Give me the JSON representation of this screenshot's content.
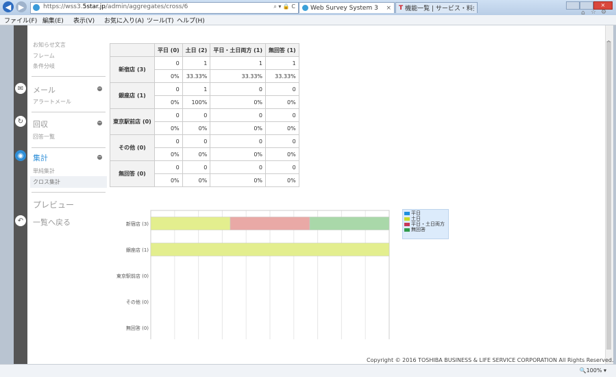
{
  "browser": {
    "url_prefix": "https://wss3.",
    "url_domain": "5star.jp",
    "url_path": "/admin/aggregates/cross/6",
    "addr_icons": "⌕ ▾ 🔒 C",
    "tab_active": "Web Survey System 3",
    "tab_other": "機能一覧 | サービス・料金 - ...",
    "menu": [
      "ファイル(F)",
      "編集(E)",
      "表示(V)",
      "お気に入り(A)",
      "ツール(T)",
      "ヘルプ(H)"
    ],
    "zoom": "100%"
  },
  "sidebar": {
    "top_items": [
      "お知らせ文言",
      "フレーム",
      "条件分岐"
    ],
    "mail": {
      "label": "メール",
      "sub": [
        "アラートメール"
      ]
    },
    "collect": {
      "label": "回収",
      "sub": [
        "回答一覧"
      ]
    },
    "aggregate": {
      "label": "集計",
      "sub": [
        "単純集計",
        "クロス集計"
      ]
    },
    "preview": "プレビュー",
    "back": "一覧へ戻る"
  },
  "table": {
    "columns": [
      "平日 (0)",
      "土日 (2)",
      "平日・土日両方 (1)",
      "無回答 (1)"
    ],
    "rows": [
      {
        "label": "新宿店 (3)",
        "counts": [
          "0",
          "1",
          "1",
          "1"
        ],
        "pcts": [
          "0%",
          "33.33%",
          "33.33%",
          "33.33%"
        ]
      },
      {
        "label": "銀座店 (1)",
        "counts": [
          "0",
          "1",
          "0",
          "0"
        ],
        "pcts": [
          "0%",
          "100%",
          "0%",
          "0%"
        ]
      },
      {
        "label": "東京駅前店 (0)",
        "counts": [
          "0",
          "0",
          "0",
          "0"
        ],
        "pcts": [
          "0%",
          "0%",
          "0%",
          "0%"
        ]
      },
      {
        "label": "その他 (0)",
        "counts": [
          "0",
          "0",
          "0",
          "0"
        ],
        "pcts": [
          "0%",
          "0%",
          "0%",
          "0%"
        ]
      },
      {
        "label": "無回答 (0)",
        "counts": [
          "0",
          "0",
          "0",
          "0"
        ],
        "pcts": [
          "0%",
          "0%",
          "0%",
          "0%"
        ]
      }
    ]
  },
  "chart_data": {
    "type": "bar",
    "orientation": "horizontal",
    "stacked": true,
    "categories": [
      "新宿店 (3)",
      "銀座店 (1)",
      "東京駅前店 (0)",
      "その他 (0)",
      "無回答 (0)"
    ],
    "series": [
      {
        "name": "平日",
        "color": "#2f9fe0",
        "values": [
          0,
          0,
          0,
          0,
          0
        ]
      },
      {
        "name": "土日",
        "color": "#e3ee8e",
        "values": [
          33.33,
          100,
          0,
          0,
          0
        ]
      },
      {
        "name": "平日・土日両方",
        "color": "#e9a9a6",
        "values": [
          33.33,
          0,
          0,
          0,
          0
        ]
      },
      {
        "name": "無回答",
        "color": "#a9d8a9",
        "values": [
          33.33,
          0,
          0,
          0,
          0
        ]
      }
    ],
    "xlim": [
      0,
      100
    ],
    "xticks": [
      "0",
      "10",
      "20",
      "30",
      "40",
      "50",
      "60",
      "70",
      "80",
      "90",
      "100"
    ],
    "grid": true,
    "legend_position": "top-right"
  },
  "legend_colors": [
    "#1f8fdc",
    "#c9dc2a",
    "#c8385a",
    "#2f9a4a"
  ],
  "footer": "Copyright © 2016 TOSHIBA BUSINESS & LIFE SERVICE CORPORATION All Rights Reserved."
}
